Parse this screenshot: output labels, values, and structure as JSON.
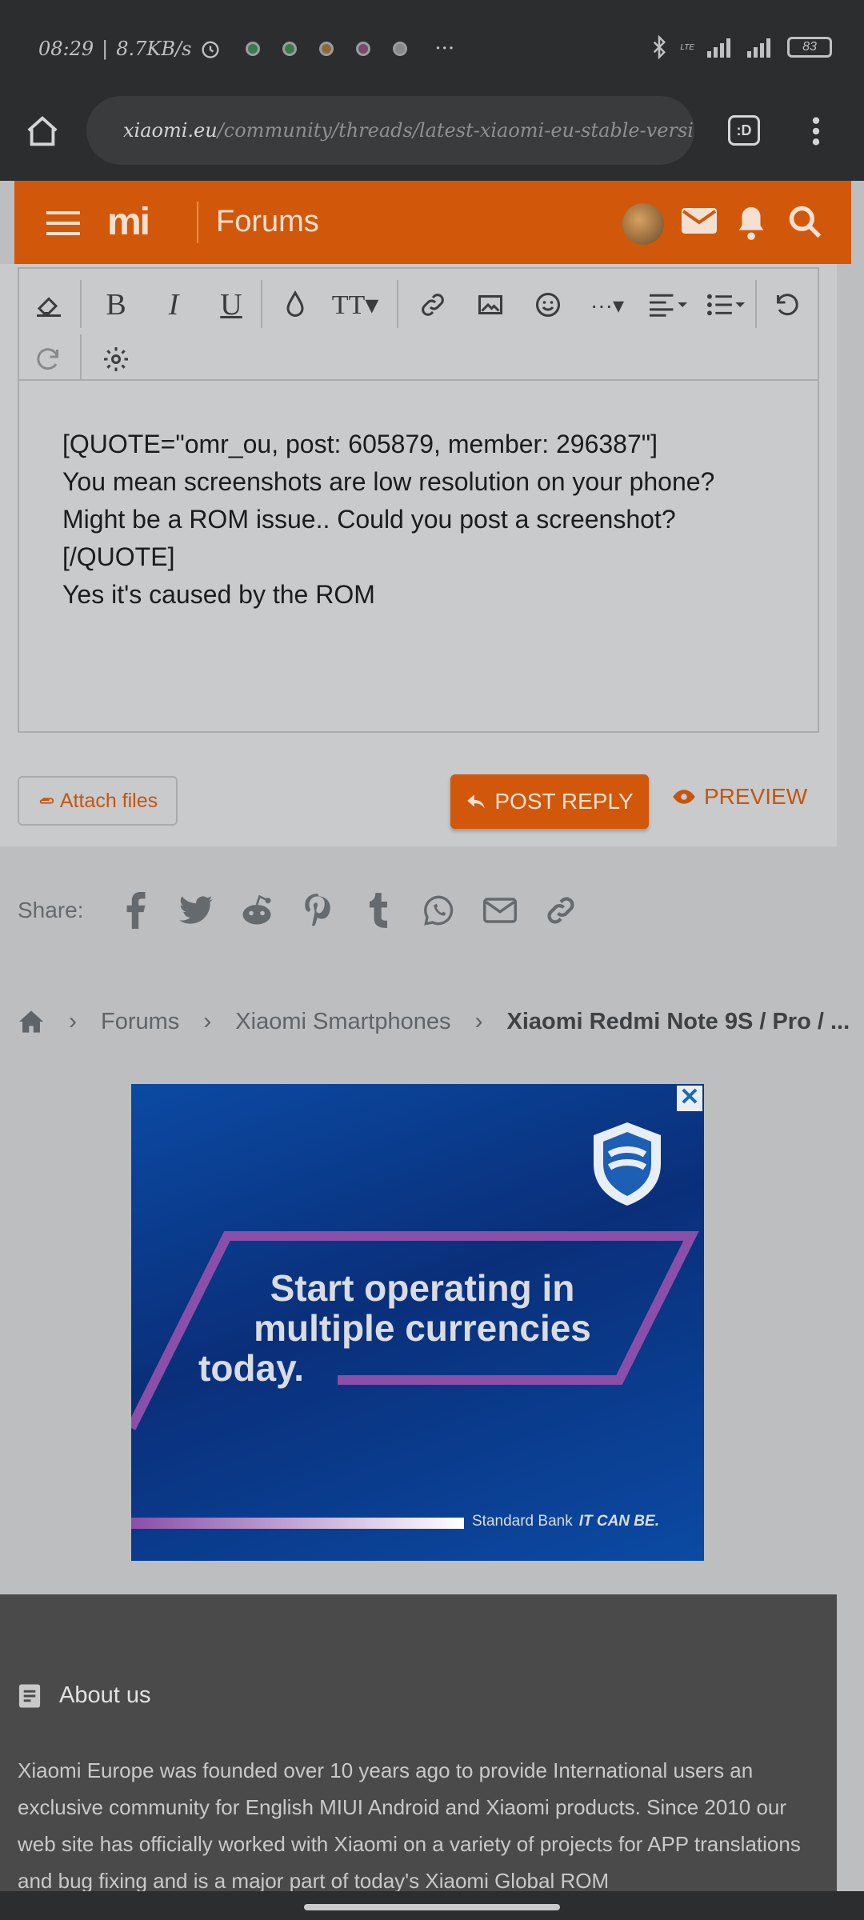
{
  "status_bar": {
    "time": "08:29",
    "net_speed": "8.7KB/s",
    "battery": "83",
    "network_label": "LTE"
  },
  "browser": {
    "url_domain": "xiaomi.eu",
    "url_path": "/community/threads/latest-xiaomi-eu-stable-version-j",
    "tabs_label": ":D"
  },
  "header": {
    "logo": "mi",
    "title": "Forums"
  },
  "editor": {
    "lines": [
      "[QUOTE=\"omr_ou, post: 605879, member: 296387\"]",
      "You mean screenshots are low resolution on your phone?",
      "Might be a ROM issue.. Could you post a screenshot?",
      "[/QUOTE]",
      "Yes it's caused by the ROM"
    ]
  },
  "actions": {
    "attach": "Attach files",
    "post_reply": "POST REPLY",
    "preview": "PREVIEW"
  },
  "share": {
    "label": "Share:"
  },
  "breadcrumb": {
    "items": [
      "Forums",
      "Xiaomi Smartphones",
      "Xiaomi Redmi Note 9S / Pro / ..."
    ]
  },
  "ad": {
    "headline_lines": [
      "Start operating in",
      "multiple currencies",
      "today."
    ],
    "brand": "Standard Bank",
    "tagline": "IT CAN BE.",
    "close": "✕"
  },
  "footer": {
    "about_title": "About us",
    "about_text": "Xiaomi Europe was founded over 10 years ago to provide International users an exclusive community for English MIUI Android and Xiaomi products. Since 2010 our web site has officially worked with Xiaomi on a variety of projects for APP translations and bug fixing and is a major part of today's Xiaomi Global ROM"
  },
  "colors": {
    "accent": "#d1580a",
    "status_bar": "#2c2d2f",
    "footer": "#4a4a4a"
  }
}
